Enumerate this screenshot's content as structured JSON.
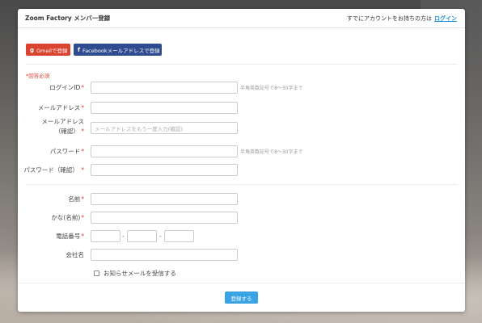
{
  "header": {
    "title": "Zoom Factory メンバー登録",
    "login_prompt": "すでにアカウントをお持ちの方は",
    "login_link": "ログイン"
  },
  "social": {
    "gmail_icon": "g",
    "gmail_label": "Gmailで登録",
    "facebook_icon": "f",
    "facebook_label": "Facebookメールアドレスで登録"
  },
  "required_note": "*回答必須",
  "form": {
    "login_id": {
      "label": "ログインID",
      "required": "*",
      "value": "",
      "hint": "半角英数記号で8〜30字まで"
    },
    "email": {
      "label": "メールアドレス",
      "required": "*",
      "value": ""
    },
    "email_confirm": {
      "label_line1": "メールアドレス",
      "label_line2": "（確認）",
      "required": "*",
      "placeholder": "メールアドレスをもう一度入力(確認)"
    },
    "password": {
      "label": "パスワード",
      "required": "*",
      "value": "",
      "hint": "半角英数記号で8〜30字まで"
    },
    "password_confirm": {
      "label": "パスワード（確認）",
      "required": "*",
      "value": ""
    },
    "name": {
      "label": "名前",
      "required": "*",
      "value": ""
    },
    "kana": {
      "label": "かな(名前)",
      "required": "*",
      "value": ""
    },
    "phone": {
      "label": "電話番号",
      "required": "*",
      "sep": "-"
    },
    "company": {
      "label": "会社名",
      "value": ""
    },
    "newsletter_label": "お知らせメールを受信する"
  },
  "submit_label": "登録する",
  "colors": {
    "accent": "#3aa3e3",
    "gmail": "#d9432f",
    "facebook": "#2f4b8f",
    "link": "#1a8fd6",
    "required": "#d9432f"
  }
}
